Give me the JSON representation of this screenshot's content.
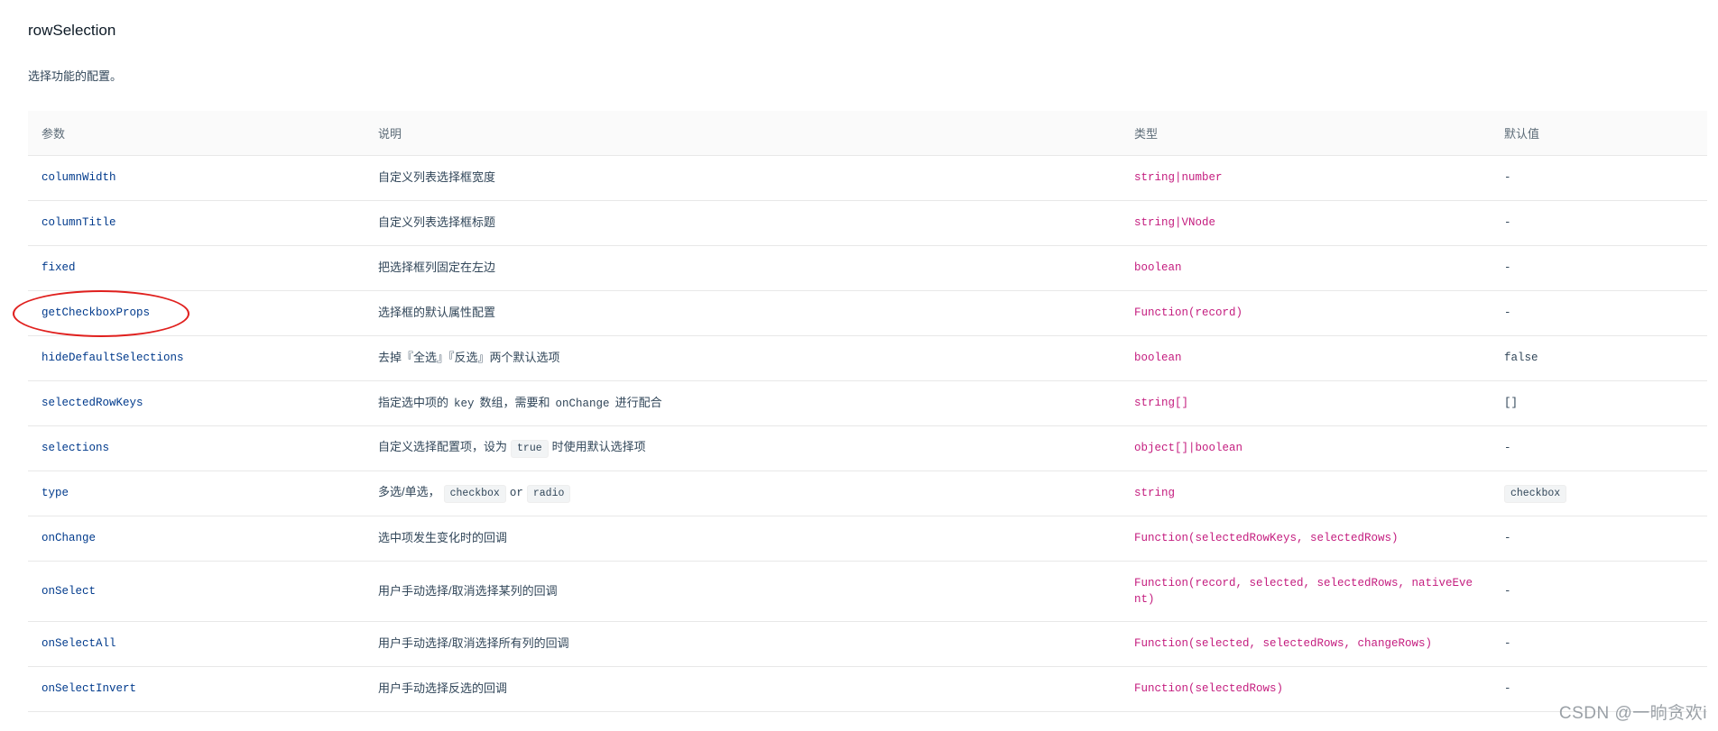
{
  "section": {
    "title": "rowSelection",
    "description": "选择功能的配置。"
  },
  "table": {
    "headers": [
      "参数",
      "说明",
      "类型",
      "默认值"
    ],
    "rows": [
      {
        "param": "columnWidth",
        "desc_pre": "自定义列表选择框宽度",
        "type": "string|number",
        "default": "-"
      },
      {
        "param": "columnTitle",
        "desc_pre": "自定义列表选择框标题",
        "type": "string|VNode",
        "default": "-"
      },
      {
        "param": "fixed",
        "desc_pre": "把选择框列固定在左边",
        "type": "boolean",
        "default": "-"
      },
      {
        "param": "getCheckboxProps",
        "desc_pre": "选择框的默认属性配置",
        "type": "Function(record)",
        "default": "-"
      },
      {
        "param": "hideDefaultSelections",
        "desc_pre": "去掉『全选』『反选』两个默认选项",
        "type": "boolean",
        "default": "false"
      },
      {
        "param": "selectedRowKeys",
        "desc_pre": "指定选中项的",
        "desc_code1": "key",
        "desc_mid": "数组，需要和",
        "desc_code2": "onChange",
        "desc_post": "进行配合",
        "type": "string[]",
        "default": "[]"
      },
      {
        "param": "selections",
        "desc_pre": "自定义选择配置项，设为",
        "desc_code1": "true",
        "desc_post": "时使用默认选择项",
        "type": "object[]|boolean",
        "default": "-"
      },
      {
        "param": "type",
        "desc_pre": "多选/单选，",
        "desc_code1": "checkbox",
        "desc_mid": "or",
        "desc_code2": "radio",
        "type": "string",
        "default": "checkbox"
      },
      {
        "param": "onChange",
        "desc_pre": "选中项发生变化时的回调",
        "type": "Function(selectedRowKeys, selectedRows)",
        "default": "-"
      },
      {
        "param": "onSelect",
        "desc_pre": "用户手动选择/取消选择某列的回调",
        "type": "Function(record, selected, selectedRows, nativeEvent)",
        "default": "-"
      },
      {
        "param": "onSelectAll",
        "desc_pre": "用户手动选择/取消选择所有列的回调",
        "type": "Function(selected, selectedRows, changeRows)",
        "default": "-"
      },
      {
        "param": "onSelectInvert",
        "desc_pre": "用户手动选择反选的回调",
        "type": "Function(selectedRows)",
        "default": "-"
      }
    ]
  },
  "colors": {
    "param": "#003a8c",
    "type": "#c41d7f",
    "annotation_circle": "#e0201e",
    "header_bg": "#fafafa",
    "border": "#e8e8e8"
  },
  "watermark": "CSDN @一晌贪欢i"
}
